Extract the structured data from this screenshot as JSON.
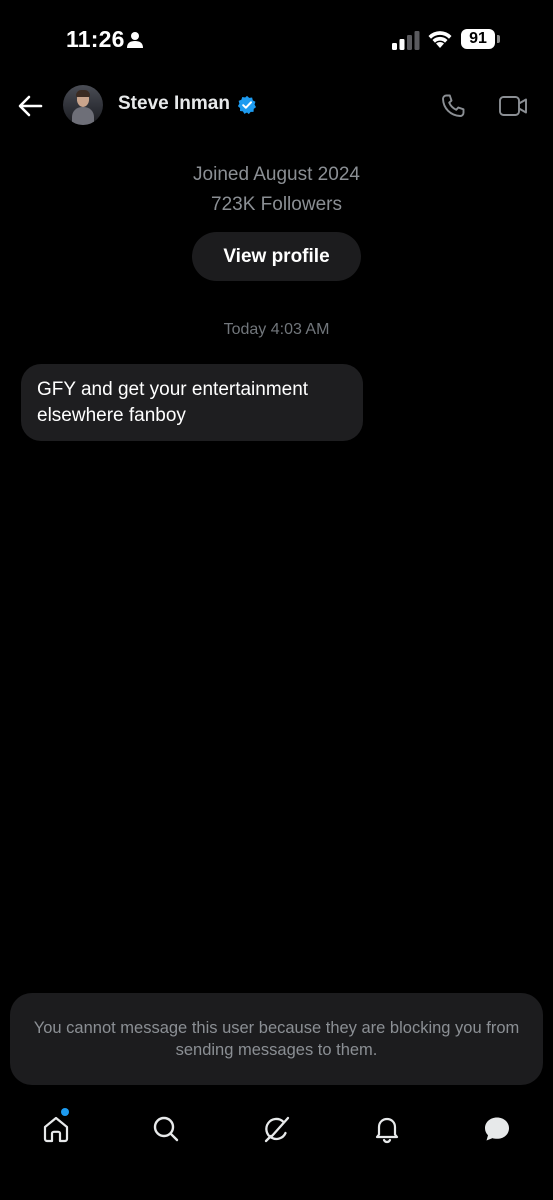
{
  "status_bar": {
    "time": "11:26",
    "battery_level": "91",
    "person_icon": "person-icon",
    "signal_icon": "cellular-signal-icon",
    "wifi_icon": "wifi-icon"
  },
  "header": {
    "name": "Steve Inman",
    "verified": true,
    "icons": {
      "back": "back-arrow-icon",
      "verified": "verified-badge-icon",
      "call": "phone-icon",
      "video": "video-camera-icon"
    }
  },
  "profile": {
    "joined": "Joined August 2024",
    "followers": "723K Followers",
    "view_profile_label": "View profile"
  },
  "conversation": {
    "timestamp": "Today 4:03 AM",
    "messages": [
      {
        "text": "GFY and get your entertainment elsewhere fanboy"
      }
    ]
  },
  "blocked_notice": {
    "text": "You cannot message this user because they are blocking you from sending messages to them."
  },
  "bottom_nav": {
    "items": [
      {
        "icon": "home-icon",
        "has_notification_dot": true
      },
      {
        "icon": "search-icon"
      },
      {
        "icon": "grok-icon"
      },
      {
        "icon": "bell-icon"
      },
      {
        "icon": "message-bubble-icon",
        "active": true
      }
    ]
  },
  "colors": {
    "background": "#000000",
    "accent": "#1d9bf0",
    "secondary_text": "#8b8f94",
    "bubble": "#1e1e20"
  }
}
